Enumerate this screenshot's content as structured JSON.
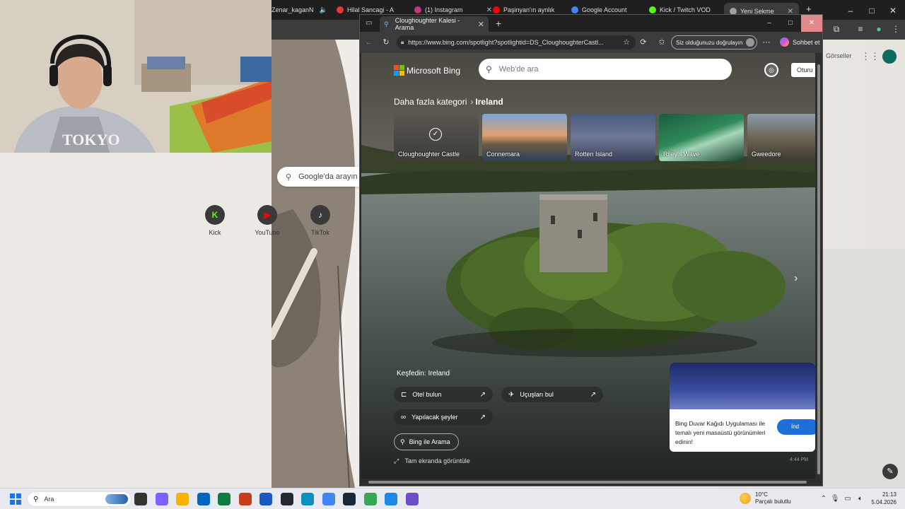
{
  "bg_chrome": {
    "tabs": [
      {
        "label": "Zenar_kaganN",
        "color": "#7fba00"
      },
      {
        "label": "Hilal Sancagi - A",
        "color": "#e53935"
      },
      {
        "label": "(1) Instagram",
        "color": "#c13584"
      },
      {
        "label": "Paşinyan'ın aynlık",
        "color": "#ff0000"
      },
      {
        "label": "Google Account",
        "color": "#4285f4"
      },
      {
        "label": "Kick / Twitch VOD",
        "color": "#53fc18"
      },
      {
        "label": "Yeni Sekme",
        "color": "#9aa0a6"
      }
    ],
    "search_placeholder": "Google'da arayın",
    "shortcuts": [
      {
        "label": "Kick",
        "glyph": "K",
        "color": "#53fc18"
      },
      {
        "label": "YouTube",
        "glyph": "▶",
        "color": "#ff0000"
      },
      {
        "label": "TikTok",
        "glyph": "♪",
        "color": "#ffffff"
      }
    ],
    "gorseller": "Görseller"
  },
  "edge": {
    "tab_title": "Cloughoughter Kalesi - Arama",
    "url": "https://www.bing.com/spotlight?spotlightid=DS_CloughoughterCastl...",
    "verify_label": "Siz olduğunuzu doğrulayın",
    "copilot_label": "Sohbet et"
  },
  "bing": {
    "brand": "Microsoft Bing",
    "search_placeholder": "Web'de ara",
    "signin_label": "Oturu",
    "breadcrumb_root": "Daha fazla kategori",
    "breadcrumb_current": "Ireland",
    "categories": [
      {
        "label": "Cloughoughter Castle"
      },
      {
        "label": "Connemara"
      },
      {
        "label": "Rotten Island"
      },
      {
        "label": "Riley's Wave"
      },
      {
        "label": "Gweedore"
      }
    ],
    "explore_title": "Keşfedin: Ireland",
    "explore_buttons": [
      {
        "label": "Otel bulun",
        "icon": "bed-icon"
      },
      {
        "label": "Uçuşları bul",
        "icon": "plane-icon"
      },
      {
        "label": "Yapılacak şeyler",
        "icon": "binoculars-icon"
      }
    ],
    "search_with_bing": "Bing ile Arama",
    "fullscreen": "Tam ekranda görüntüle",
    "promo_text": "Bing Duvar Kağıdı Uygulaması ile temalı yeni masaüstü görünümleri edinin!",
    "promo_button": "İnd",
    "promo_time": "4:44 PM"
  },
  "taskbar": {
    "search_label": "Ara",
    "apps": [
      {
        "name": "task-view-icon",
        "color": "#333333"
      },
      {
        "name": "copilot-icon",
        "color": "#7b61ff"
      },
      {
        "name": "file-explorer-icon",
        "color": "#f4b400"
      },
      {
        "name": "store-icon",
        "color": "#0067c0"
      },
      {
        "name": "excel-icon",
        "color": "#107c41"
      },
      {
        "name": "powerpoint-icon",
        "color": "#c43e1c"
      },
      {
        "name": "word-icon",
        "color": "#185abd"
      },
      {
        "name": "github-icon",
        "color": "#24292f"
      },
      {
        "name": "edge-icon",
        "color": "#0f8fbf"
      },
      {
        "name": "chrome-icon",
        "color": "#4285f4"
      },
      {
        "name": "steam-icon",
        "color": "#1b2838"
      },
      {
        "name": "chrome-alt-icon",
        "color": "#34a853"
      },
      {
        "name": "app-blue-icon",
        "color": "#1e88e5"
      },
      {
        "name": "app-purple-icon",
        "color": "#6a4fc8"
      }
    ],
    "weather_temp": "10°C",
    "weather_desc": "Parçalı bulutlu",
    "time": "21:13",
    "date": "5.04.2026"
  }
}
